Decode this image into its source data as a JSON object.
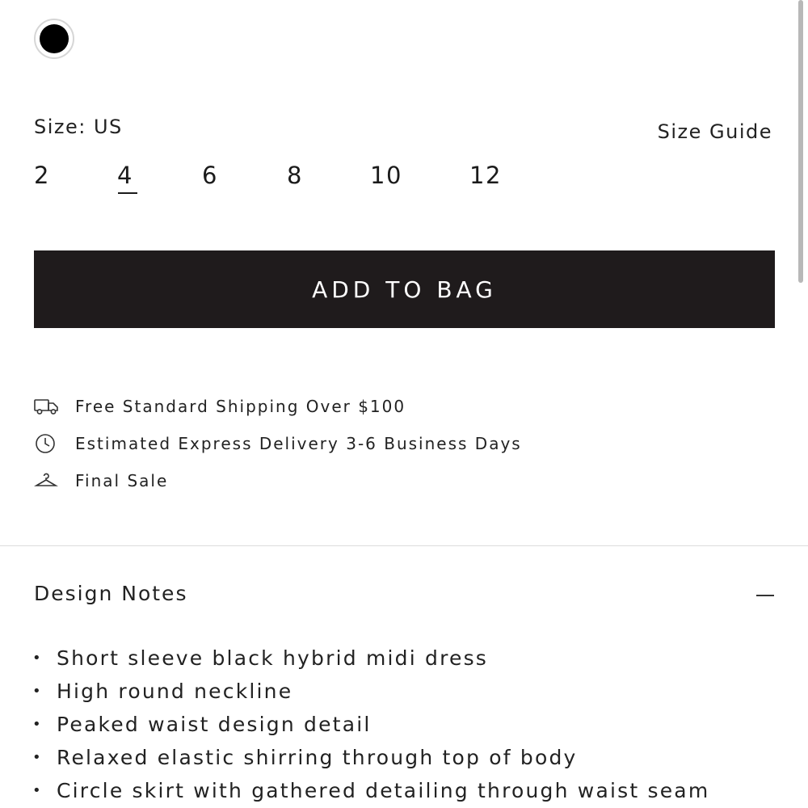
{
  "color": {
    "selected_swatch": "black",
    "swatch_hex": "#000000"
  },
  "size": {
    "label": "Size: US",
    "guide_label": "Size Guide",
    "options": [
      "2",
      "4",
      "6",
      "8",
      "10",
      "12"
    ],
    "selected": "4"
  },
  "cta": {
    "add_to_bag": "ADD TO BAG",
    "button_color": "#1f1b1c"
  },
  "perks": [
    {
      "icon": "truck-icon",
      "text": "Free Standard Shipping Over $100"
    },
    {
      "icon": "clock-icon",
      "text": "Estimated Express Delivery 3-6 Business Days"
    },
    {
      "icon": "hanger-icon",
      "text": "Final Sale"
    }
  ],
  "design_notes": {
    "title": "Design Notes",
    "toggle_icon": "minus-icon",
    "items": [
      "Short sleeve black hybrid midi dress",
      "High round neckline",
      "Peaked waist design detail",
      "Relaxed elastic shirring through top of body",
      "Circle skirt with gathered detailing through waist seam"
    ]
  }
}
